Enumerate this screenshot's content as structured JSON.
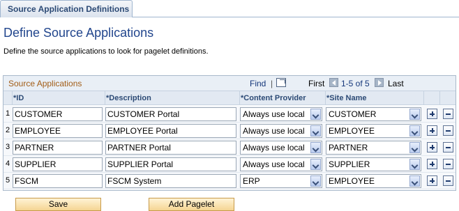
{
  "tab": {
    "label": "Source Application Definitions"
  },
  "page": {
    "title": "Define Source Applications",
    "instructions": "Define the source applications to look for pagelet definitions."
  },
  "grid": {
    "title": "Source Applications",
    "find": "Find",
    "separator": "|",
    "first": "First",
    "range": "1-5 of 5",
    "last": "Last",
    "columns": {
      "id": {
        "req": "*",
        "label": "ID"
      },
      "description": {
        "req": "*",
        "label": "Description"
      },
      "content_provider": {
        "req": "*",
        "label": "Content Provider"
      },
      "site_name": {
        "req": "*",
        "label": "Site Name"
      }
    },
    "rows": [
      {
        "num": "1",
        "id": "CUSTOMER",
        "description": "CUSTOMER Portal",
        "content_provider": "Always use local",
        "site_name": "CUSTOMER"
      },
      {
        "num": "2",
        "id": "EMPLOYEE",
        "description": "EMPLOYEE Portal",
        "content_provider": "Always use local",
        "site_name": "EMPLOYEE"
      },
      {
        "num": "3",
        "id": "PARTNER",
        "description": "PARTNER Portal",
        "content_provider": "Always use local",
        "site_name": "PARTNER"
      },
      {
        "num": "4",
        "id": "SUPPLIER",
        "description": "SUPPLIER Portal",
        "content_provider": "Always use local",
        "site_name": "SUPPLIER"
      },
      {
        "num": "5",
        "id": "FSCM",
        "description": "FSCM System",
        "content_provider": "ERP",
        "site_name": "EMPLOYEE"
      }
    ]
  },
  "buttons": {
    "save": "Save",
    "add_pagelet": "Add Pagelet"
  },
  "colors": {
    "title": "#22468d",
    "grid_title": "#a25d17",
    "required": "#c60000",
    "button": "#f5d593"
  }
}
